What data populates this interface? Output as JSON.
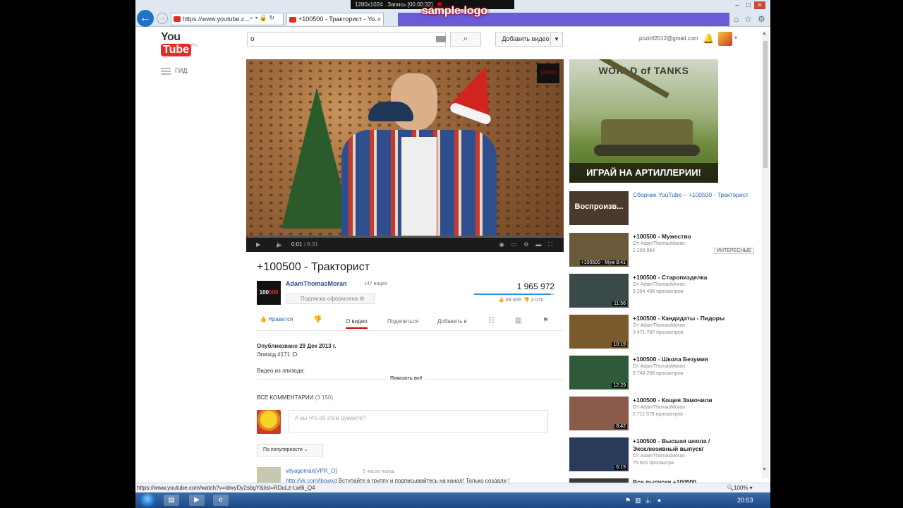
{
  "browser": {
    "address": "https://www.youtube.c...",
    "address_icons": "⌕ ▾ 🔒 ↻",
    "tab_title": "+100500 - Тракторист - Yo...",
    "tab_close": "×"
  },
  "recorder": {
    "size": "1280x1024",
    "status": "Запись [00:00:32]",
    "logo": "sample logo"
  },
  "youtube": {
    "logo_you": "You",
    "logo_tube": "Tube",
    "logo_region": "RU",
    "search_value": "о",
    "upload_label": "Добавить видео",
    "user_email": "pozinf2012@gmail.com",
    "guide_label": "ГИД"
  },
  "player": {
    "time_current": "0:01",
    "time_total": "/ 8:31",
    "progress_fraction": 0.002,
    "badge": "100500"
  },
  "video": {
    "title": "+100500 - Тракторист",
    "channel": "AdamThomasMoran",
    "channel_video_count": "147 видео",
    "channel_thumb_text": "100",
    "channel_thumb_hl": "500",
    "subscribe_label": "Подписка оформлена",
    "views": "1 965 972",
    "likes": "69 309",
    "dislikes": "3 076",
    "like_ratio": 0.957,
    "like_label": "Нравится",
    "tab_about": "О видео",
    "tab_share": "Поделиться",
    "tab_add": "Добавить в",
    "published": "Опубликовано 29 Дек 2013 г.",
    "episode": "Эпизод #171 :D",
    "from_episode": "Видео из эпизода:",
    "show_all": "Показать всё"
  },
  "comments": {
    "title": "ВСЕ КОММЕНТАРИИ",
    "count": "(3 150)",
    "placeholder": "А вы что об этом думаете?",
    "sort_label": "По популярности",
    "first": {
      "author": "vityagoman[VPR_O]",
      "time": "8 часов назад",
      "link": "http://vk.com/jbowxd",
      "text": " Вступайте в группу и подписывайтесь на канал! Только создали !"
    }
  },
  "ad": {
    "brand": "WORLD of TANKS",
    "cta": "ИГРАЙ НА АРТИЛЛЕРИИ!"
  },
  "recommended": [
    {
      "title": "Сборник YouTube – +100500 - Тракторист",
      "overlay": "Воспроизв...",
      "by": "",
      "views": "",
      "duration": "",
      "badge": "",
      "color": "#4a3a2e"
    },
    {
      "title": "+100500 - Мужество",
      "overlay": "",
      "by": "От AdamThomasMoran",
      "views": "2 258 864",
      "duration": "+100500 - Муж 8:41",
      "badge": "ИНТЕРЕСНЫЕ",
      "color": "#6a5a3a"
    },
    {
      "title": "+100500 - Старопизделка",
      "overlay": "",
      "by": "От AdamThomasMoran",
      "views": "3 284 496 просмотров",
      "duration": "11:56",
      "badge": "",
      "color": "#3a4a4a"
    },
    {
      "title": "+100500 - Кандидаты - Пидоры",
      "overlay": "",
      "by": "От AdamThomasMoran",
      "views": "3 471 787 просмотров",
      "duration": "10:19",
      "badge": "",
      "color": "#7a5a2a"
    },
    {
      "title": "+100500 - Школа Безумия",
      "overlay": "",
      "by": "От AdamThomasMoran",
      "views": "5 748 268 просмотров",
      "duration": "12:29",
      "badge": "",
      "color": "#2e5a3a"
    },
    {
      "title": "+100500 - Кощея Замочили",
      "overlay": "",
      "by": "От AdamThomasMoran",
      "views": "2 711 578 просмотров",
      "duration": "8:42",
      "badge": "",
      "color": "#8a5a4a"
    },
    {
      "title": "+100500 - Высшая школа /Эксклюзивный выпуск/",
      "overlay": "",
      "by": "От AdamThomasMoran",
      "views": "75 924 просмотра",
      "duration": "6:19",
      "badge": "",
      "color": "#2a3a5a"
    },
    {
      "title": "Все выпуски +100500",
      "overlay": "",
      "by": "",
      "views": "",
      "duration": "",
      "badge": "",
      "color": "#3a3a3a"
    }
  ],
  "status": {
    "url": "https://www.youtube.com/watch?v=IdwyDy2sbgY&list=RDuLz-Lw8i_Q4",
    "zoom": "100%"
  },
  "taskbar": {
    "clock": "20:53"
  }
}
